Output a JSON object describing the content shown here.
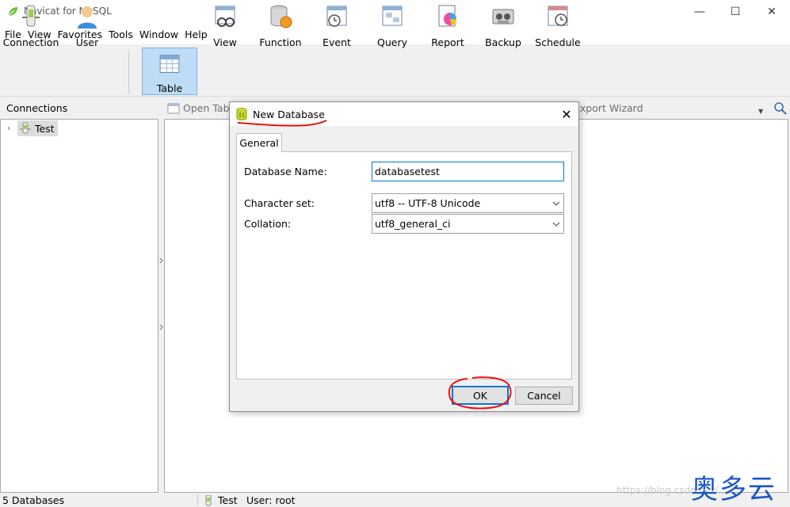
{
  "window": {
    "title": "Navicat for MySQL",
    "minimize_glyph": "—",
    "maximize_glyph": "☐",
    "close_glyph": "✕"
  },
  "menu": [
    "File",
    "View",
    "Favorites",
    "Tools",
    "Window",
    "Help"
  ],
  "toolbar": {
    "items": [
      {
        "label": "Connection",
        "icon": "connection-icon"
      },
      {
        "label": "User",
        "icon": "user-icon"
      },
      {
        "label": "Table",
        "icon": "table-icon",
        "active": true
      },
      {
        "label": "View",
        "icon": "view-icon"
      },
      {
        "label": "Function",
        "icon": "function-icon"
      },
      {
        "label": "Event",
        "icon": "event-icon"
      },
      {
        "label": "Query",
        "icon": "query-icon"
      },
      {
        "label": "Report",
        "icon": "report-icon"
      },
      {
        "label": "Backup",
        "icon": "backup-icon"
      },
      {
        "label": "Schedule",
        "icon": "schedule-icon"
      }
    ]
  },
  "connections": {
    "header": "Connections",
    "tree": [
      {
        "label": "Test",
        "icon": "connection-icon"
      }
    ]
  },
  "main": {
    "open_table": "Open Tab",
    "export_wizard": "Export Wizard"
  },
  "dialog": {
    "title": "New Database",
    "close_glyph": "✕",
    "tab": "General",
    "db_name_label": "Database Name:",
    "db_name_value": "databasetest",
    "charset_label": "Character set:",
    "charset_value": "utf8 -- UTF-8 Unicode",
    "collation_label": "Collation:",
    "collation_value": "utf8_general_ci",
    "ok_label": "OK",
    "cancel_label": "Cancel"
  },
  "status": {
    "databases": "5 Databases",
    "connection": "Test",
    "user": "User: root"
  },
  "watermark": {
    "url": "https://blog.csdn.net/...",
    "logo": "奥多云"
  },
  "colors": {
    "accent": "#0078d7",
    "annotation": "#e81010",
    "watermark_logo": "#1a55c8"
  }
}
